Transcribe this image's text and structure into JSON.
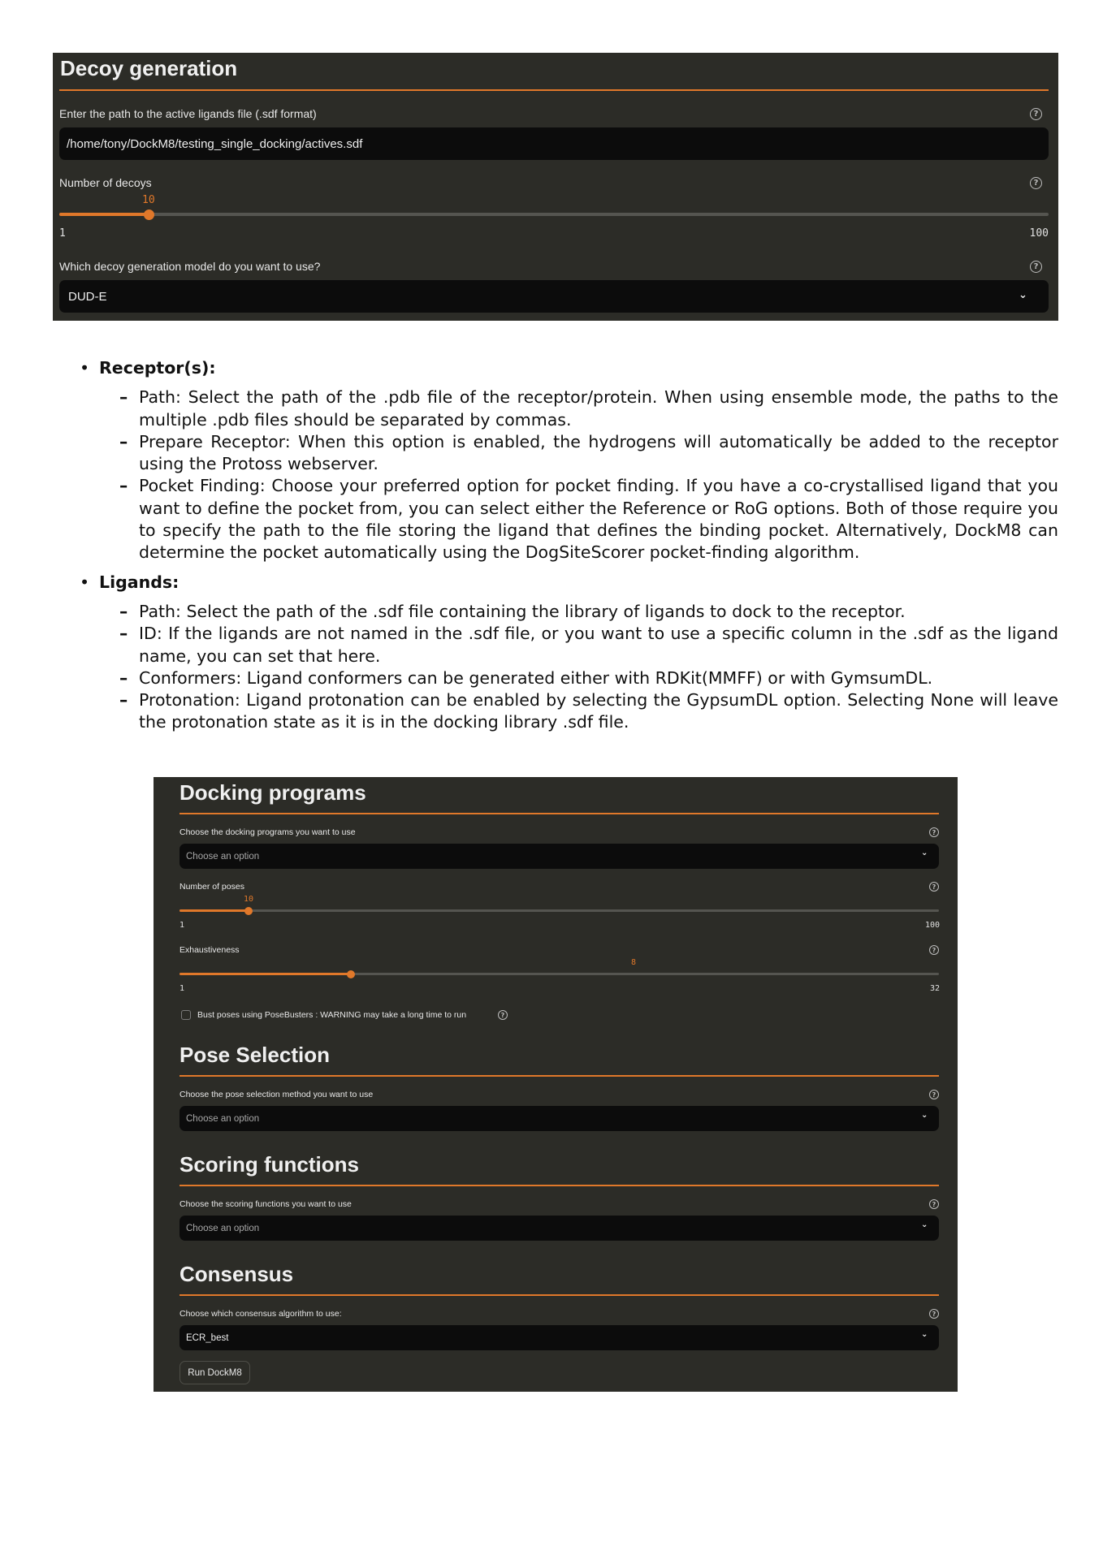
{
  "decoy_panel": {
    "title": "Decoy generation",
    "actives_label": "Enter the path to the active ligands file (.sdf format)",
    "actives_value": "/home/tony/DockM8/testing_single_docking/actives.sdf",
    "num_decoys_label": "Number of decoys",
    "num_decoys_value": "10",
    "num_decoys_min": "1",
    "num_decoys_max": "100",
    "model_label": "Which decoy generation model do you want to use?",
    "model_value": "DUD-E"
  },
  "doc": {
    "receptor": {
      "heading": "Receptor(s):",
      "items": [
        "Path: Select the path of the .pdb file of the receptor/protein.  When using ensemble mode, the paths to the multiple .pdb files should be separated by commas.",
        "Prepare Receptor: When this option is enabled, the hydrogens will automatically be added to the receptor using the Protoss webserver.",
        "Pocket Finding: Choose your preferred option for pocket finding. If you have a co-crystallised ligand that you want to define the pocket from, you can select either the Reference or RoG options. Both of those require you to specify the path to the file storing the ligand that defines the binding pocket.  Alternatively, DockM8 can determine the pocket automatically using the DogSiteScorer pocket-finding algorithm."
      ]
    },
    "ligands": {
      "heading": "Ligands:",
      "items": [
        "Path: Select the path of the .sdf file containing the library of ligands to dock to the receptor.",
        "ID: If the ligands are not named in the .sdf file, or you want to use a specific column in the .sdf as the ligand name, you can set that here.",
        "Conformers: Ligand conformers can be generated either with RDKit(MMFF) or with GymsumDL.",
        "Protonation: Ligand protonation can be enabled by selecting the GypsumDL option. Selecting None will leave the protonation state as it is in the docking library .sdf file."
      ]
    }
  },
  "docking_panel": {
    "docking_title": "Docking programs",
    "programs_label": "Choose the docking programs you want to use",
    "programs_placeholder": "Choose an option",
    "poses_label": "Number of poses",
    "poses_value": "10",
    "poses_min": "1",
    "poses_max": "100",
    "exhaustiveness_label": "Exhaustiveness",
    "exhaustiveness_value": "8",
    "exhaustiveness_min": "1",
    "exhaustiveness_max": "32",
    "bust_label": "Bust poses using PoseBusters : WARNING may take a long time to run",
    "pose_selection_title": "Pose Selection",
    "pose_selection_label": "Choose the pose selection method you want to use",
    "pose_selection_placeholder": "Choose an option",
    "scoring_title": "Scoring functions",
    "scoring_label": "Choose the scoring functions you want to use",
    "scoring_placeholder": "Choose an option",
    "consensus_title": "Consensus",
    "consensus_label": "Choose which consensus algorithm to use:",
    "consensus_value": "ECR_best",
    "run_button": "Run DockM8"
  },
  "colors": {
    "panel_bg": "#2c2c27",
    "accent": "#e0782a",
    "field_bg": "#0c0c0c"
  },
  "icons": [
    "help-icon",
    "chevron-down-icon"
  ]
}
